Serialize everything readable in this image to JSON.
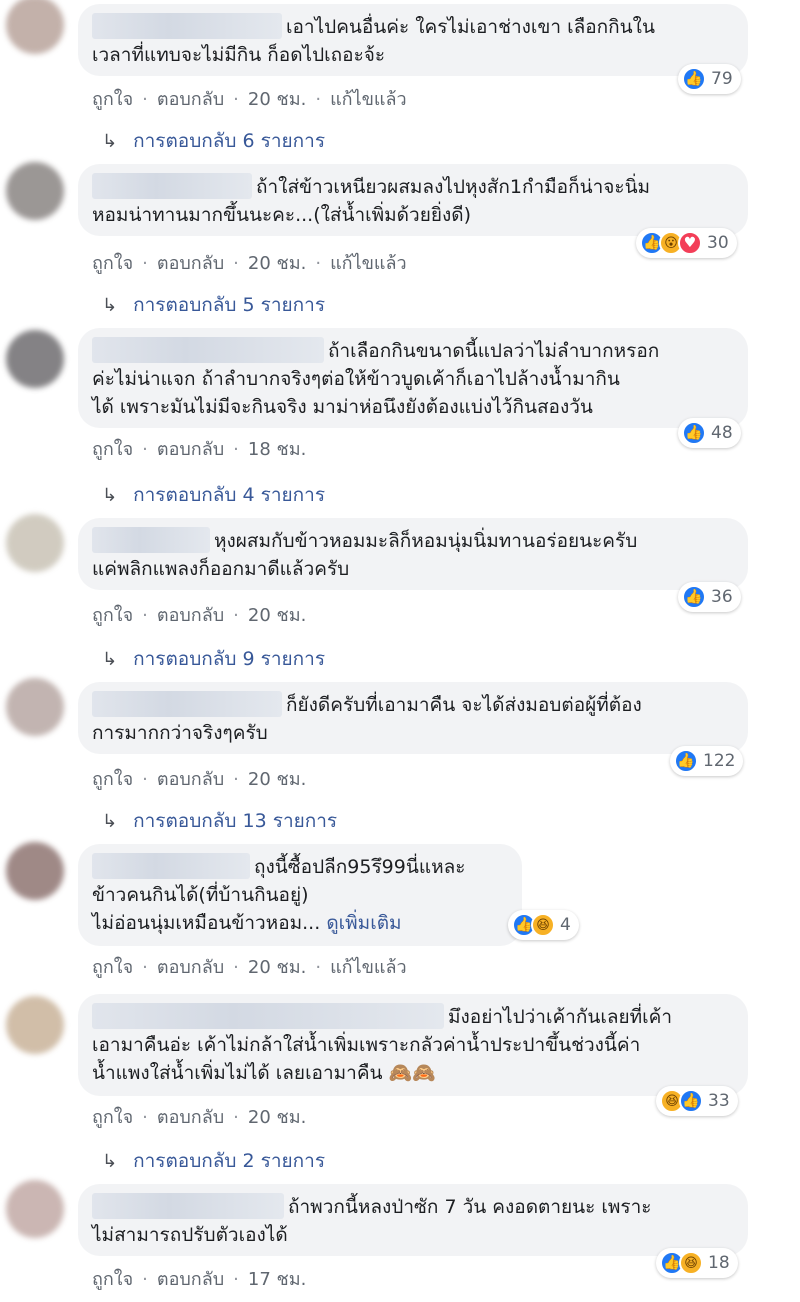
{
  "comments": [
    {
      "lines": [
        "เอาไปคนอื่นค่ะ ใครไม่เอาช่างเขา เลือกกินใน",
        "เวลาที่แทบจะไม่มีกิน ก็อดไปเถอะจ้ะ"
      ],
      "reaction_count": "79",
      "reactions": [
        "like"
      ],
      "action_like": "ถูกใจ",
      "action_reply": "ตอบกลับ",
      "time": "20 ชม.",
      "edited": "แก้ไขแล้ว",
      "replies": "การตอบกลับ 6 รายการ"
    },
    {
      "lines": [
        "ถ้าใส่ข้าวเหนียวผสมลงไปหุงสัก1กำมือก็น่าจะนิ่ม",
        "หอมน่าทานมากขึ้นนะคะ...(ใส่น้ำเพิ่มด้วยยิ่งดี)"
      ],
      "reaction_count": "30",
      "reactions": [
        "like",
        "wow",
        "love"
      ],
      "action_like": "ถูกใจ",
      "action_reply": "ตอบกลับ",
      "time": "20 ชม.",
      "edited": "แก้ไขแล้ว",
      "replies": "การตอบกลับ 5 รายการ"
    },
    {
      "lines": [
        "ถ้าเลือกกินขนาดนี้แปลว่าไม่ลำบากหรอก",
        "ค่ะไม่น่าแจก ถ้าลำบากจริงๆต่อให้ข้าวบูดเค้าก็เอาไปล้างน้ำมากิน",
        "ได้ เพราะมันไม่มีจะกินจริง มาม่าห่อนึงยังต้องแบ่งไว้กินสองวัน"
      ],
      "reaction_count": "48",
      "reactions": [
        "like"
      ],
      "action_like": "ถูกใจ",
      "action_reply": "ตอบกลับ",
      "time": "18 ชม.",
      "edited": "",
      "replies": "การตอบกลับ 4 รายการ"
    },
    {
      "lines": [
        "หุงผสมกับข้าวหอมมะลิก็หอมนุ่มนิ่มทานอร่อยนะครับ",
        "แค่พลิกแพลงก็ออกมาดีแล้วครับ"
      ],
      "reaction_count": "36",
      "reactions": [
        "like"
      ],
      "action_like": "ถูกใจ",
      "action_reply": "ตอบกลับ",
      "time": "20 ชม.",
      "edited": "",
      "replies": "การตอบกลับ 9 รายการ"
    },
    {
      "lines": [
        "ก็ยังดีครับที่เอามาคืน จะได้ส่งมอบต่อผู้ที่ต้อง",
        "การมากกว่าจริงๆครับ"
      ],
      "reaction_count": "122",
      "reactions": [
        "like"
      ],
      "action_like": "ถูกใจ",
      "action_reply": "ตอบกลับ",
      "time": "20 ชม.",
      "edited": "",
      "replies": "การตอบกลับ 13 รายการ"
    },
    {
      "lines": [
        "ถุงนี้ซื้อปลีก95รึ99นี่แหละ",
        "ข้าวคนกินได้(ที่บ้านกินอยู่)",
        "ไม่อ่อนนุ่มเหมือนข้าวหอม..."
      ],
      "see_more": "ดูเพิ่มเติม",
      "reaction_count": "4",
      "reactions": [
        "like",
        "haha"
      ],
      "action_like": "ถูกใจ",
      "action_reply": "ตอบกลับ",
      "time": "20 ชม.",
      "edited": "แก้ไขแล้ว",
      "replies": ""
    },
    {
      "lines": [
        "มึงอย่าไปว่าเค้ากันเลยที่เค้า",
        "เอามาคืนอ่ะ เค้าไม่กล้าใส่น้ำเพิ่มเพราะกลัวค่าน้ำประปาขึ้นช่วงนี้ค่า",
        "น้ำแพงใส่น้ำเพิ่มไม่ได้ เลยเอามาคืน 🙈🙈"
      ],
      "reaction_count": "33",
      "reactions": [
        "haha",
        "like"
      ],
      "action_like": "ถูกใจ",
      "action_reply": "ตอบกลับ",
      "time": "20 ชม.",
      "edited": "",
      "replies": "การตอบกลับ 2 รายการ"
    },
    {
      "lines": [
        "ถ้าพวกนี้หลงป่าซัก 7 วัน คงอดตายนะ เพราะ",
        "ไม่สามารถปรับตัวเองได้"
      ],
      "reaction_count": "18",
      "reactions": [
        "like",
        "haha"
      ],
      "action_like": "ถูกใจ",
      "action_reply": "ตอบกลับ",
      "time": "17 ชม.",
      "edited": "",
      "replies": ""
    }
  ],
  "icons": {
    "like": "thumbs-up-icon",
    "wow": "wow-face-icon",
    "love": "heart-icon",
    "haha": "laugh-face-icon",
    "reply_arrow": "reply-arrow-icon"
  },
  "colors": {
    "bubble": "#f2f3f5",
    "link": "#385898",
    "meta": "#606770",
    "like": "#2078f4"
  }
}
